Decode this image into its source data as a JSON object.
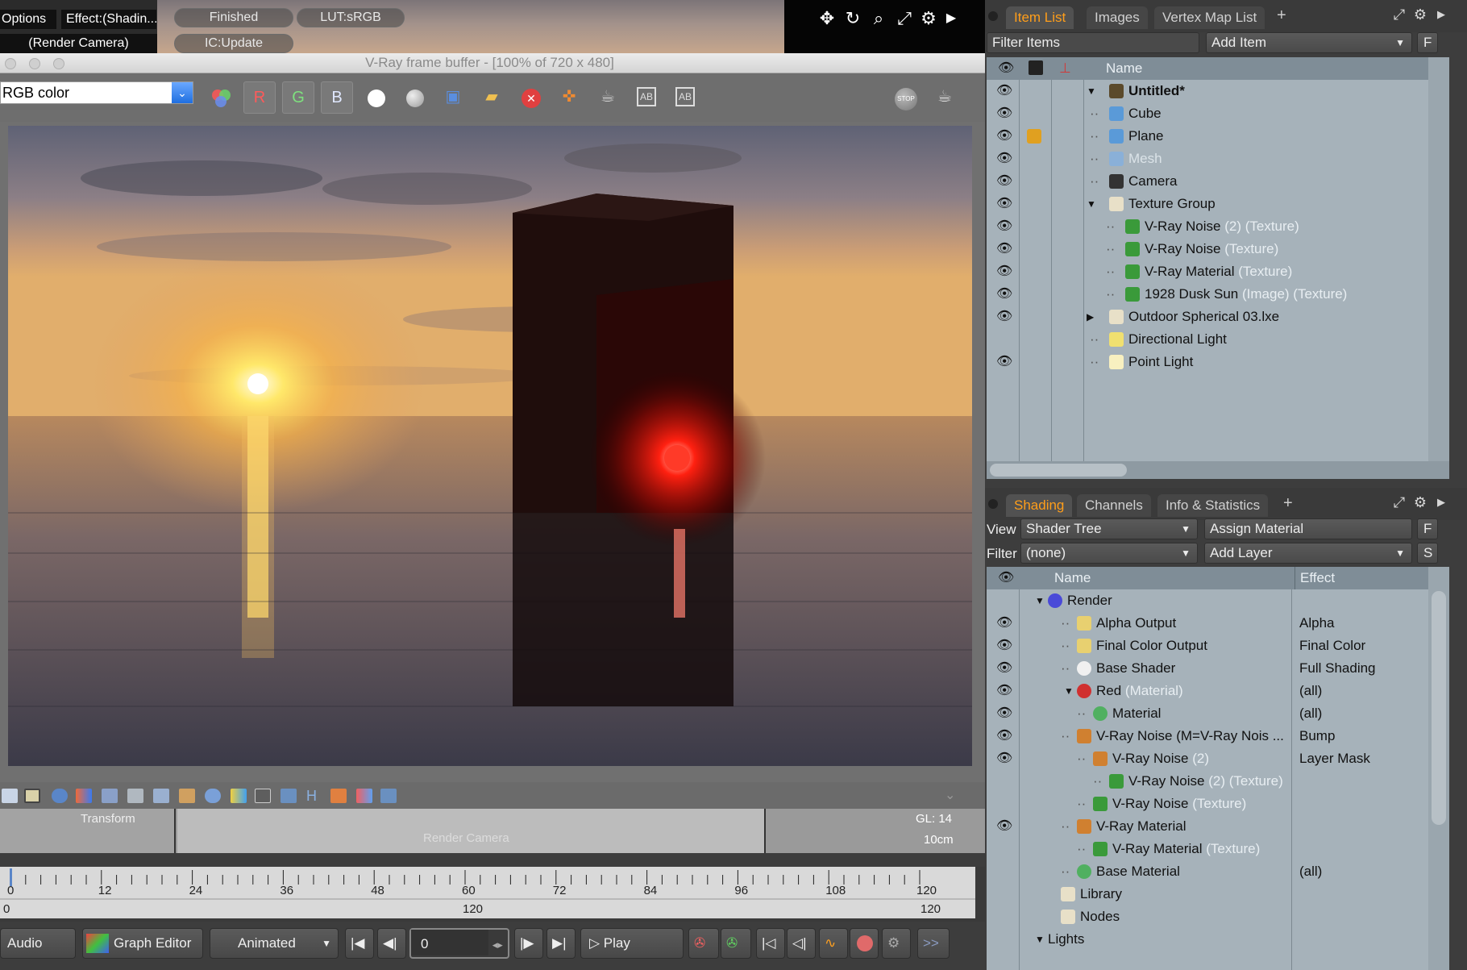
{
  "top_toolbar": {
    "options": "Options",
    "effect": "Effect:(Shadin...",
    "status": "Finished",
    "lut": "LUT:sRGB",
    "camera": "(Render Camera)",
    "ic": "IC:Update"
  },
  "vfb": {
    "title": "V-Ray frame buffer - [100% of 720 x 480]",
    "channel": "RGB color",
    "r_label": "R",
    "g_label": "G",
    "b_label": "B",
    "stop_label": "STOP"
  },
  "viewport": {
    "transform_label": "Transform",
    "render_camera_label": "Render Camera",
    "gl": "GL: 14",
    "scale": "10cm"
  },
  "timeline": {
    "ticks": [
      "0",
      "12",
      "24",
      "36",
      "48",
      "60",
      "72",
      "84",
      "96",
      "108",
      "120"
    ],
    "range_start": "0",
    "range_mid": "120",
    "range_end": "120"
  },
  "transport": {
    "audio": "Audio",
    "graph_editor": "Graph Editor",
    "animated": "Animated",
    "frame": "0",
    "play": "Play"
  },
  "item_panel": {
    "tabs": [
      "Item List",
      "Images",
      "Vertex Map List"
    ],
    "plus": "+",
    "filter_placeholder": "Filter Items",
    "add_item": "Add Item",
    "f_button": "F",
    "column_name": "Name",
    "items": [
      {
        "name": "Untitled*",
        "sub": ""
      },
      {
        "name": "Cube",
        "sub": ""
      },
      {
        "name": "Plane",
        "sub": ""
      },
      {
        "name": "Mesh",
        "sub": ""
      },
      {
        "name": "Camera",
        "sub": ""
      },
      {
        "name": "Texture Group",
        "sub": ""
      },
      {
        "name": "V-Ray Noise",
        "sub": "(2) (Texture)"
      },
      {
        "name": "V-Ray Noise",
        "sub": "(Texture)"
      },
      {
        "name": "V-Ray Material",
        "sub": "(Texture)"
      },
      {
        "name": "1928 Dusk Sun",
        "sub": "(Image) (Texture)"
      },
      {
        "name": "Outdoor Spherical 03.lxe",
        "sub": ""
      },
      {
        "name": "Directional Light",
        "sub": ""
      },
      {
        "name": "Point Light",
        "sub": ""
      }
    ]
  },
  "shading_panel": {
    "tabs": [
      "Shading",
      "Channels",
      "Info & Statistics"
    ],
    "plus": "+",
    "view_label": "View",
    "view_value": "Shader Tree",
    "assign_material": "Assign Material",
    "f_button": "F",
    "filter_label": "Filter",
    "filter_value": "(none)",
    "add_layer": "Add Layer",
    "s_button": "S",
    "column_name": "Name",
    "column_effect": "Effect",
    "rows": [
      {
        "name": "Render",
        "sub": "",
        "effect": ""
      },
      {
        "name": "Alpha Output",
        "sub": "",
        "effect": "Alpha"
      },
      {
        "name": "Final Color Output",
        "sub": "",
        "effect": "Final Color"
      },
      {
        "name": "Base Shader",
        "sub": "",
        "effect": "Full Shading"
      },
      {
        "name": "Red",
        "sub": "(Material)",
        "effect": "(all)"
      },
      {
        "name": "Material",
        "sub": "",
        "effect": "(all)"
      },
      {
        "name": "V-Ray Noise (M=V-Ray Nois ...",
        "sub": "",
        "effect": "Bump"
      },
      {
        "name": "V-Ray Noise",
        "sub": "(2)",
        "effect": "Layer Mask"
      },
      {
        "name": "V-Ray Noise",
        "sub": "(2) (Texture)",
        "effect": ""
      },
      {
        "name": "V-Ray Noise",
        "sub": "(Texture)",
        "effect": ""
      },
      {
        "name": "V-Ray Material",
        "sub": "",
        "effect": ""
      },
      {
        "name": "V-Ray Material",
        "sub": "(Texture)",
        "effect": ""
      },
      {
        "name": "Base Material",
        "sub": "",
        "effect": "(all)"
      },
      {
        "name": "Library",
        "sub": "",
        "effect": ""
      },
      {
        "name": "Nodes",
        "sub": "",
        "effect": ""
      },
      {
        "name": "Lights",
        "sub": "",
        "effect": ""
      }
    ]
  },
  "colors": {
    "accent": "#ff9e1a",
    "tree_bg": "#a6b2ba",
    "header_bg": "#7f8d97"
  }
}
